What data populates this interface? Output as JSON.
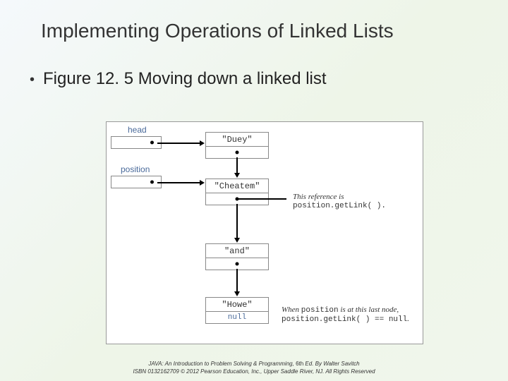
{
  "title": "Implementing Operations of Linked Lists",
  "bullet": "Figure 12. 5 Moving down a linked list",
  "figure": {
    "head_label": "head",
    "position_label": "position",
    "nodes": [
      "\"Duey\"",
      "\"Cheatem\"",
      "\"and\"",
      "\"Howe\"",
      "null"
    ],
    "note1_a": "This reference is",
    "note1_b": "position.getLink( ).",
    "note2_a": "When ",
    "note2_b": "position",
    "note2_c": " is at this last node,",
    "note2_d": "position.getLink( ) == null",
    "note2_e": "."
  },
  "footer": {
    "line1a": "JAVA: An Introduction to Problem Solving & Programming, ",
    "line1b": "6th",
    "line1c": " Ed. By Walter Savitch",
    "line2": "ISBN 0132162709 © 2012 Pearson Education, Inc., Upper Saddle River, NJ. All Rights Reserved"
  }
}
